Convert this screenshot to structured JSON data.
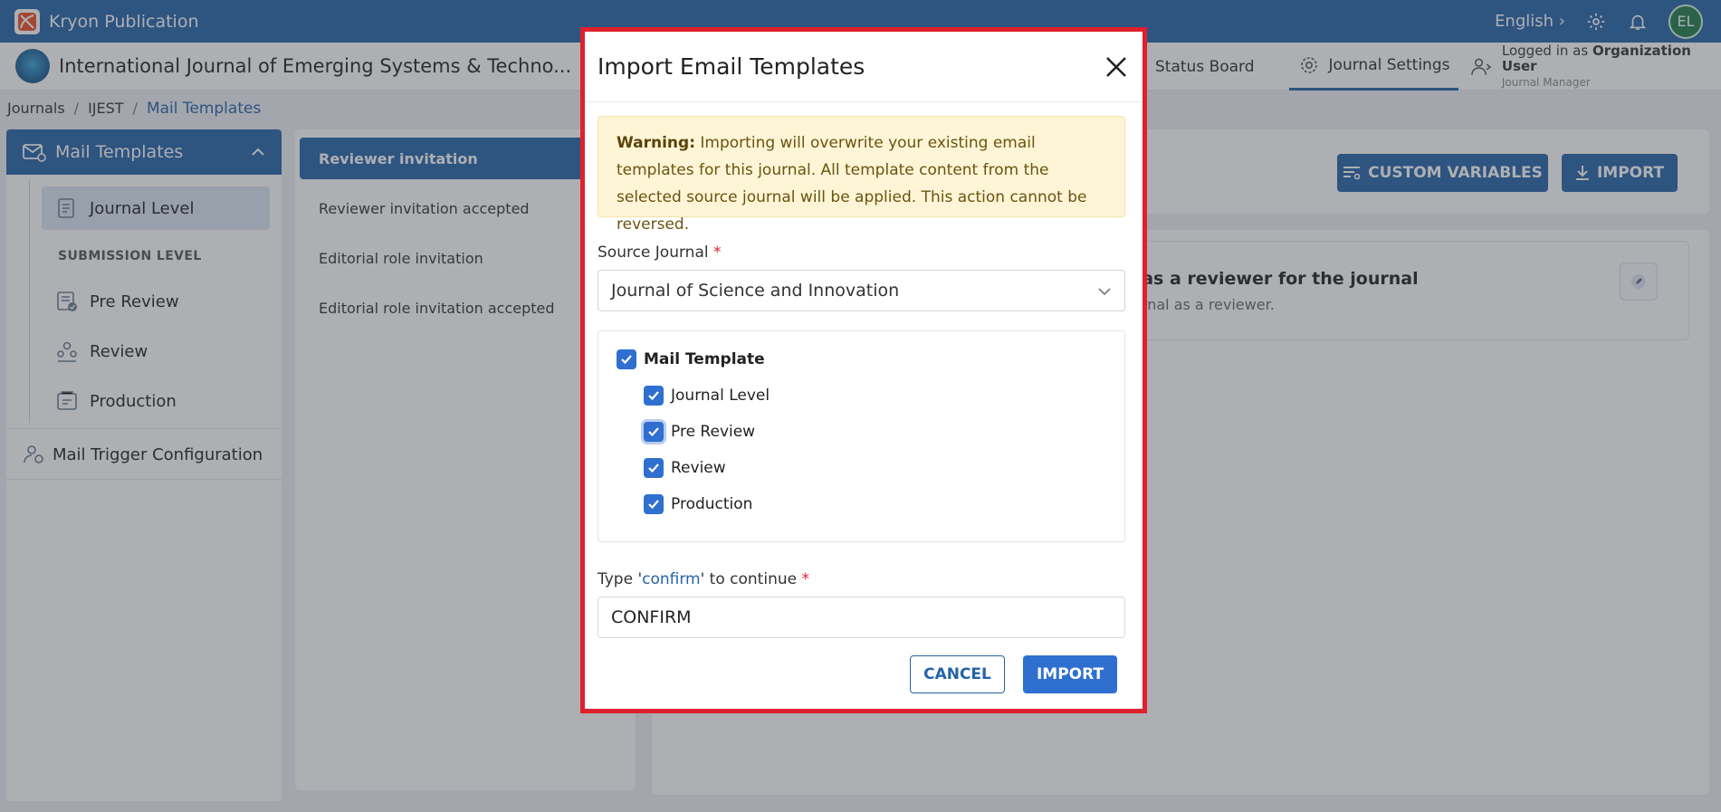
{
  "app": {
    "name": "Kryon Publication",
    "language": "English",
    "avatar_initials": "EL",
    "brand_color": "#2563a8"
  },
  "journal": {
    "title": "International Journal of Emerging Systems & Techno...",
    "nav": [
      {
        "label": "Status Board",
        "icon": "status-board-icon",
        "active": false
      },
      {
        "label": "Journal Settings",
        "icon": "gear-icon",
        "active": true
      }
    ],
    "logged_prefix": "Logged in as",
    "logged_user": "Organization User",
    "logged_role": "Journal Manager"
  },
  "breadcrumb": {
    "items": [
      "Journals",
      "IJEST",
      "Mail Templates"
    ]
  },
  "sidebar": {
    "header": "Mail Templates",
    "items": [
      {
        "label": "Journal Level",
        "icon": "journal-level-icon",
        "selected": true
      },
      {
        "label": "Pre Review",
        "icon": "pre-review-icon"
      },
      {
        "label": "Review",
        "icon": "review-icon"
      },
      {
        "label": "Production",
        "icon": "production-icon"
      }
    ],
    "section_label": "SUBMISSION LEVEL",
    "trigger_label": "Mail Trigger Configuration"
  },
  "templates": {
    "items": [
      {
        "label": "Reviewer invitation",
        "selected": true
      },
      {
        "label": "Reviewer invitation accepted"
      },
      {
        "label": "Editorial role invitation"
      },
      {
        "label": "Editorial role invitation accepted"
      }
    ]
  },
  "content": {
    "custom_variables_label": "CUSTOM VARIABLES",
    "import_label": "IMPORT",
    "card_title_visible": "d as a reviewer for the journal",
    "card_sub_visible": "ournal as a reviewer."
  },
  "modal": {
    "title": "Import Email Templates",
    "warning_bold": "Warning:",
    "warning_text": " Importing will overwrite your existing email templates for this journal. All template content from the selected source journal will be applied. This action cannot be reversed.",
    "source_label": "Source Journal",
    "required_mark": "*",
    "source_value": "Journal of Science and Innovation",
    "tree": {
      "parent": "Mail Template",
      "children": [
        "Journal Level",
        "Pre Review",
        "Review",
        "Production"
      ]
    },
    "confirm_prefix": "Type '",
    "confirm_word": "confirm",
    "confirm_suffix": "' to continue",
    "confirm_value": "CONFIRM",
    "cancel_label": "CANCEL",
    "import_label": "IMPORT",
    "highlight_color": "#e0202c"
  }
}
